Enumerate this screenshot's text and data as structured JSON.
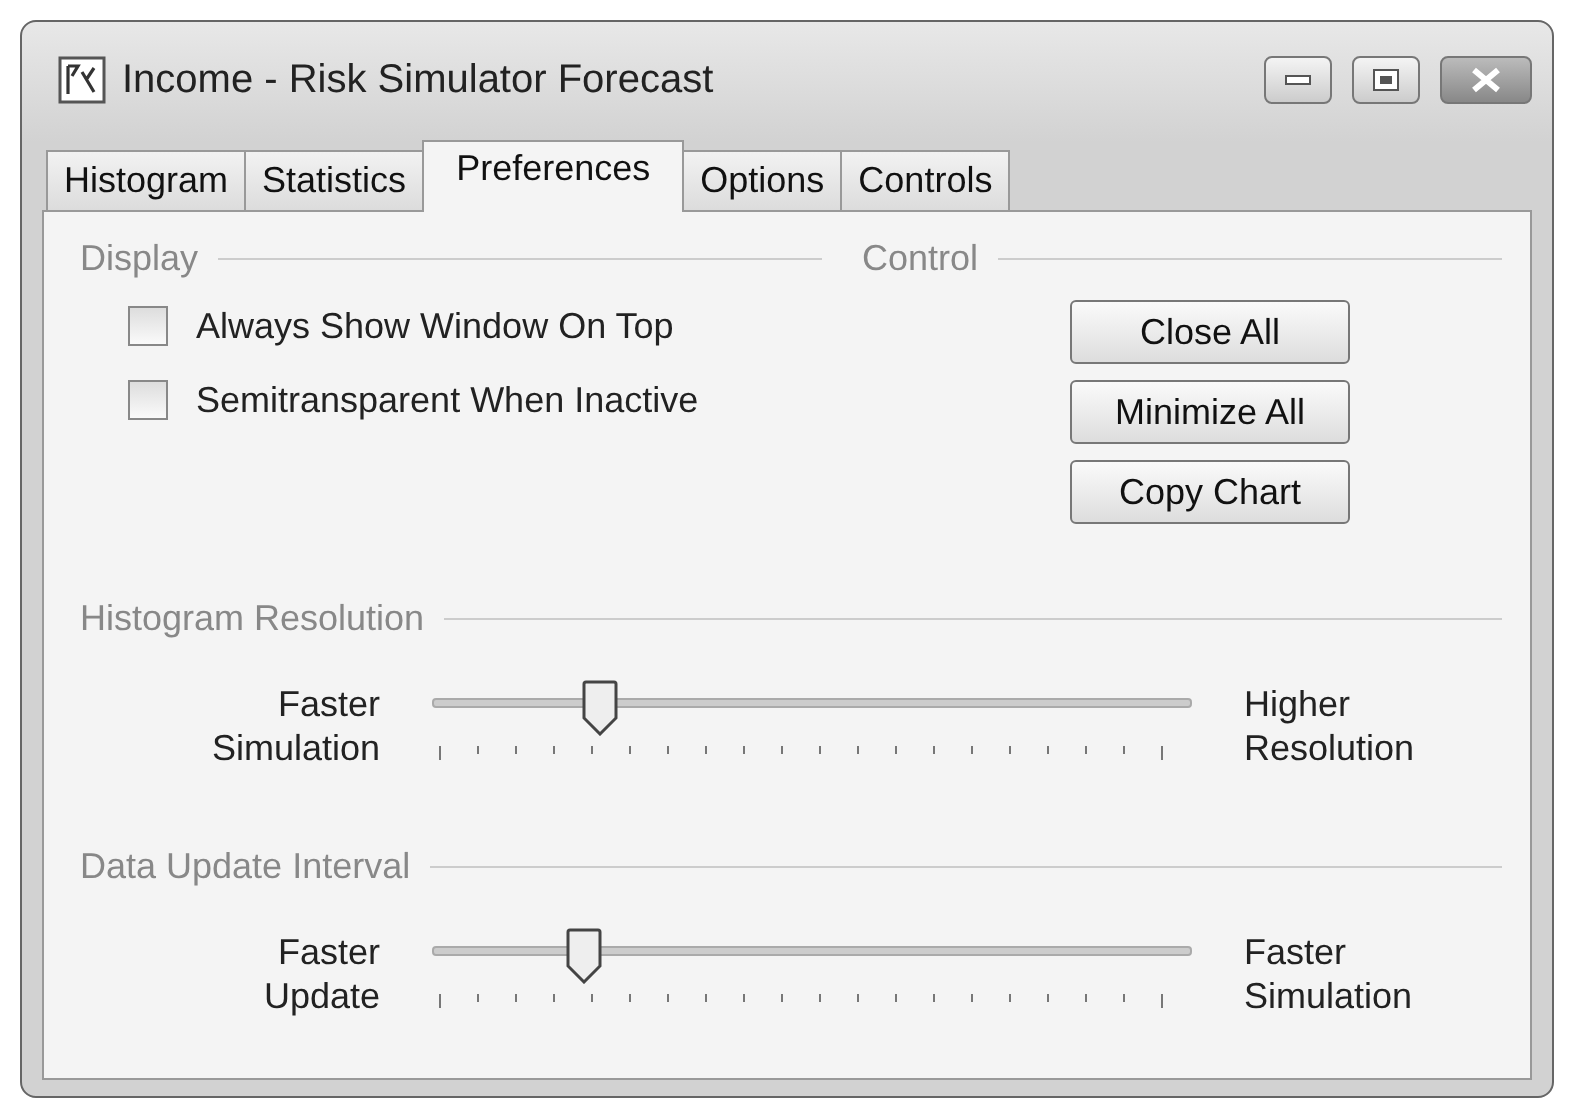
{
  "window": {
    "title": "Income - Risk Simulator Forecast"
  },
  "tabs": [
    {
      "label": "Histogram",
      "selected": false
    },
    {
      "label": "Statistics",
      "selected": false
    },
    {
      "label": "Preferences",
      "selected": true
    },
    {
      "label": "Options",
      "selected": false
    },
    {
      "label": "Controls",
      "selected": false
    }
  ],
  "display": {
    "heading": "Display",
    "options": [
      {
        "label": "Always Show Window On Top",
        "checked": false
      },
      {
        "label": "Semitransparent When Inactive",
        "checked": false
      }
    ]
  },
  "control": {
    "heading": "Control",
    "buttons": [
      "Close All",
      "Minimize All",
      "Copy Chart"
    ]
  },
  "sliders": [
    {
      "heading": "Histogram Resolution",
      "left": [
        "Faster",
        "Simulation"
      ],
      "right": [
        "Higher",
        "Resolution"
      ],
      "level": 0.22
    },
    {
      "heading": "Data Update Interval",
      "left": [
        "Faster",
        "Update"
      ],
      "right": [
        "Faster",
        "Simulation"
      ],
      "level": 0.2
    }
  ]
}
